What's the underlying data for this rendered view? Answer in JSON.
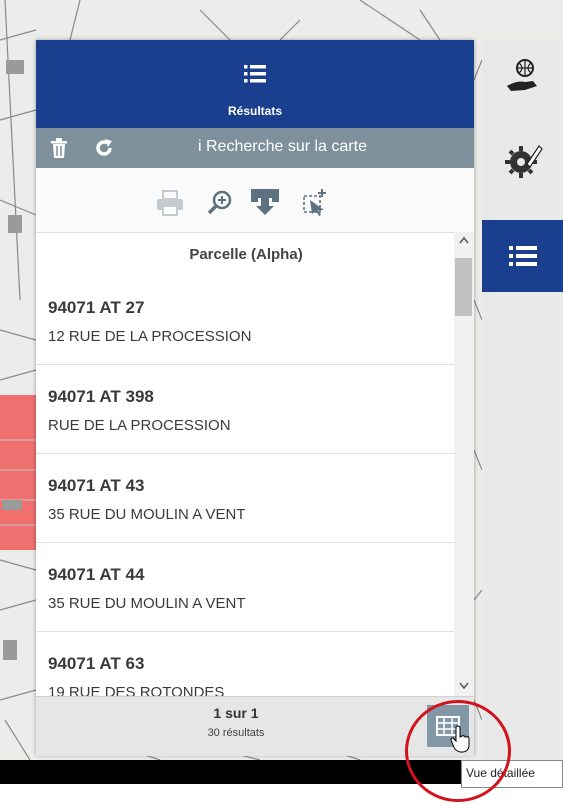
{
  "panel": {
    "title": "Résultats",
    "info_link": "i Recherche sur la carte",
    "column_header": "Parcelle (Alpha)",
    "items": [
      {
        "ref": "94071 AT 27",
        "address": "12 RUE DE LA PROCESSION"
      },
      {
        "ref": "94071 AT 398",
        "address": "RUE DE LA PROCESSION"
      },
      {
        "ref": "94071 AT 43",
        "address": "35 RUE DU MOULIN A VENT"
      },
      {
        "ref": "94071 AT 44",
        "address": "35 RUE DU MOULIN A VENT"
      },
      {
        "ref": "94071 AT 63",
        "address": "19 RUE DES ROTONDES"
      }
    ],
    "page": "1 sur 1",
    "count": "30 résultats"
  },
  "tooltip": "Vue détaillée",
  "icons": [
    "list-icon",
    "trash-icon",
    "refresh-icon",
    "print-icon",
    "zoom-icon",
    "export-icon",
    "select-icon",
    "globe-hand-icon",
    "gear-pencil-icon",
    "table-icon",
    "cursor-hand-icon"
  ],
  "colors": {
    "header": "#1b3f8f",
    "toolbar": "#7d909b",
    "highlight": "#d2121c",
    "map_parcel": "#f07070"
  }
}
